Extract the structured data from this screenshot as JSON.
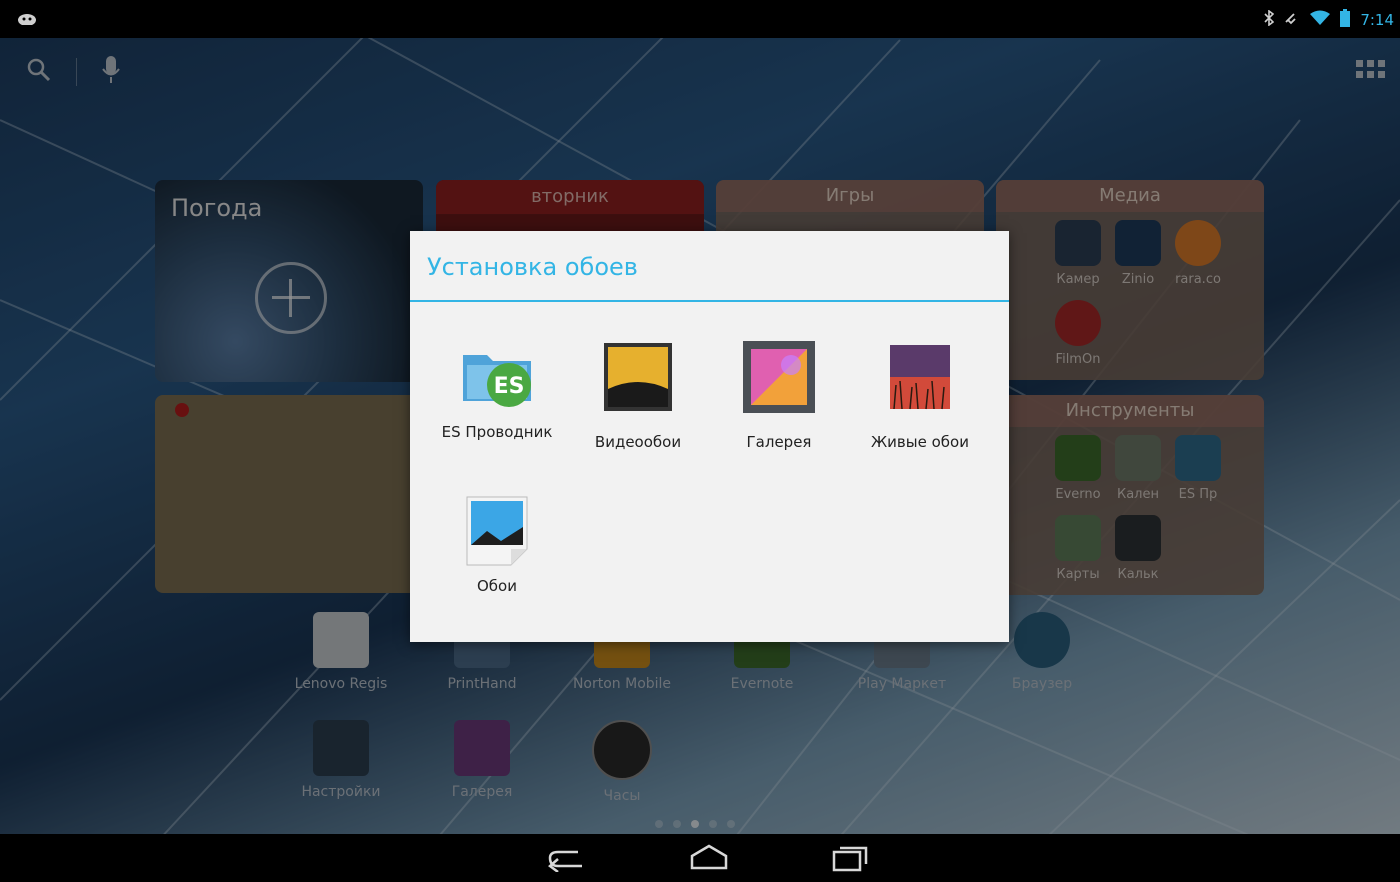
{
  "status_bar": {
    "time": "7:14"
  },
  "home": {
    "weather_widget": {
      "title": "Погода"
    },
    "calendar_widget": {
      "day": "вторник"
    },
    "folders": {
      "games": {
        "title": "Игры"
      },
      "media": {
        "title": "Медиа",
        "apps": [
          "Камер",
          "Zinio",
          "rara.co",
          "FilmOn"
        ]
      },
      "tools": {
        "title": "Инструменты",
        "apps": [
          "Everno",
          "Кален",
          "ES Пр",
          "Карты",
          "Кальк"
        ]
      }
    },
    "dock_row1": [
      "Lenovo Regis",
      "PrintHand",
      "Norton Mobile",
      "Evernote",
      "Play Маркет",
      "Браузер"
    ],
    "dock_row2": [
      "Настройки",
      "Галерея",
      "Часы"
    ]
  },
  "dialog": {
    "title": "Установка обоев",
    "options": [
      {
        "label": "ES Проводник",
        "icon": "es-explorer-icon"
      },
      {
        "label": "Видеообои",
        "icon": "video-wallpaper-icon"
      },
      {
        "label": "Галерея",
        "icon": "gallery-icon"
      },
      {
        "label": "Живые обои",
        "icon": "live-wallpaper-icon"
      },
      {
        "label": "Обои",
        "icon": "wallpapers-icon"
      }
    ]
  },
  "colors": {
    "accent": "#33b5e5"
  }
}
